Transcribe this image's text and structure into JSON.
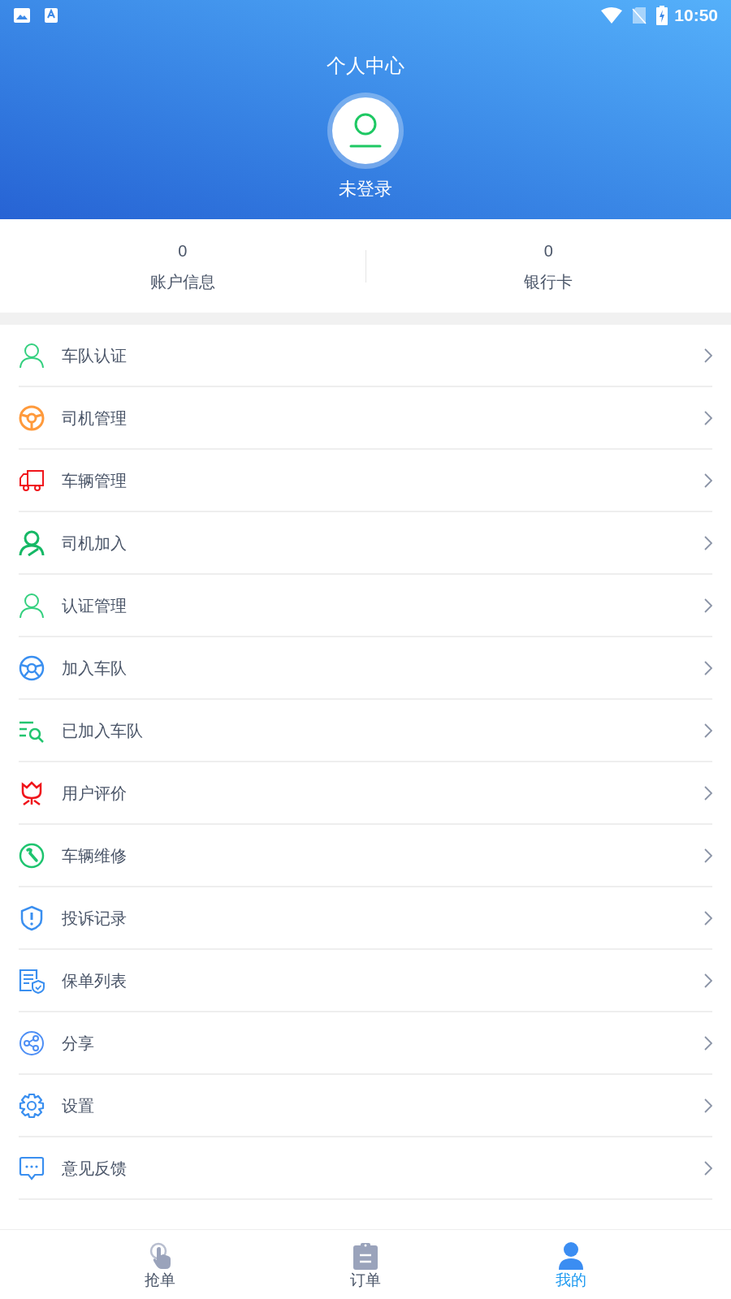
{
  "status_bar": {
    "time": "10:50"
  },
  "header": {
    "title": "个人中心",
    "user_label": "未登录"
  },
  "stats": [
    {
      "value": "0",
      "label": "账户信息"
    },
    {
      "value": "0",
      "label": "银行卡"
    }
  ],
  "menu": [
    {
      "kind": "person",
      "label": "车队认证"
    },
    {
      "kind": "wheel-orange",
      "label": "司机管理"
    },
    {
      "kind": "truck",
      "label": "车辆管理"
    },
    {
      "kind": "person-add",
      "label": "司机加入"
    },
    {
      "kind": "person",
      "label": "认证管理"
    },
    {
      "kind": "wheel-blue",
      "label": "加入车队"
    },
    {
      "kind": "list-search",
      "label": "已加入车队"
    },
    {
      "kind": "flower",
      "label": "用户评价"
    },
    {
      "kind": "wrench",
      "label": "车辆维修"
    },
    {
      "kind": "shield",
      "label": "投诉记录"
    },
    {
      "kind": "policy",
      "label": "保单列表"
    },
    {
      "kind": "share",
      "label": "分享"
    },
    {
      "kind": "gear",
      "label": "设置"
    },
    {
      "kind": "chat",
      "label": "意见反馈"
    }
  ],
  "bottom_nav": [
    {
      "kind": "tap",
      "label": "抢单",
      "selected": false
    },
    {
      "kind": "clipboard",
      "label": "订单",
      "selected": false
    },
    {
      "kind": "user",
      "label": "我的",
      "selected": true
    }
  ]
}
